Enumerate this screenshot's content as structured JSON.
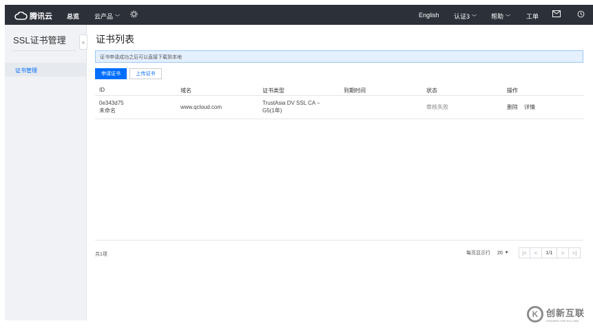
{
  "topbar": {
    "brand": "腾讯云",
    "overview": "总览",
    "products": "云产品",
    "lang": "English",
    "auth": "认证3",
    "help": "帮助",
    "ticket": "工单",
    "icons": [
      "cloud-logo-icon",
      "gear-icon",
      "mail-icon",
      "history-icon"
    ]
  },
  "sidebar": {
    "title": "SSL证书管理",
    "items": [
      {
        "label": "证书管理",
        "active": true
      }
    ],
    "collapse_glyph": "«"
  },
  "main": {
    "title": "证书列表",
    "notice": "证书申请成功之后可以直接下载到本地",
    "buttons": {
      "apply": "申请证书",
      "upload": "上传证书"
    }
  },
  "table": {
    "headers": [
      "ID",
      "域名",
      "证书类型",
      "到期时间",
      "状态",
      "操作"
    ],
    "rows": [
      {
        "id": "0e343d75",
        "name": "未命名",
        "domain": "www.qcloud.com",
        "type_line1": "TrustAsia DV SSL CA –",
        "type_line2": "G5(1年)",
        "expiry": "",
        "status": "审核失败",
        "action_delete": "删除",
        "action_detail": "详情"
      }
    ]
  },
  "footer": {
    "total": "共1项",
    "per_page_label": "每页显示行",
    "per_page": "20",
    "page": "1/1",
    "first": "|<",
    "prev": "<",
    "next": ">",
    "last": ">|"
  },
  "watermark": {
    "glyph": "K",
    "main": "创新互联",
    "sub": "CHUANG XIN HU LIAN"
  },
  "colors": {
    "topbar": "#2c3039",
    "accent": "#006eff",
    "notice_bg": "#e5f0ff",
    "sidebar_bg": "#f0f2f5"
  }
}
